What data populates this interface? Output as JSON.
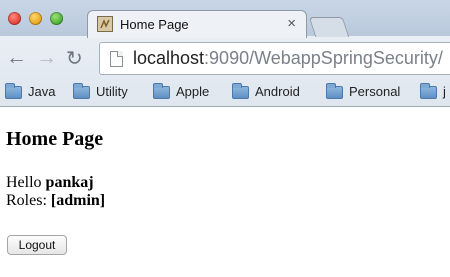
{
  "browser": {
    "tab": {
      "title": "Home Page",
      "close_glyph": "×",
      "favicon": "page-favicon-icon"
    },
    "nav": {
      "back_glyph": "←",
      "forward_glyph": "→",
      "reload_glyph": "↻"
    },
    "address": {
      "host": "localhost",
      "rest": ":9090/WebappSpringSecurity/"
    },
    "bookmarks": [
      {
        "label": "Java",
        "icon": "folder-icon"
      },
      {
        "label": "Utility",
        "icon": "folder-icon"
      },
      {
        "label": "Apple",
        "icon": "folder-icon"
      },
      {
        "label": "Android",
        "icon": "folder-icon"
      },
      {
        "label": "Personal",
        "icon": "folder-icon"
      },
      {
        "label": "j",
        "icon": "folder-icon"
      }
    ],
    "colors": {
      "close": "#e2463b",
      "minimize": "#e9a824",
      "maximize": "#4fb23a",
      "bookmark_folder": "#5f8fc2"
    }
  },
  "page": {
    "title": "Home Page",
    "greeting_prefix": "Hello",
    "username": "pankaj",
    "roles_prefix": "Roles:",
    "roles": "[admin]",
    "logout_label": "Logout"
  }
}
